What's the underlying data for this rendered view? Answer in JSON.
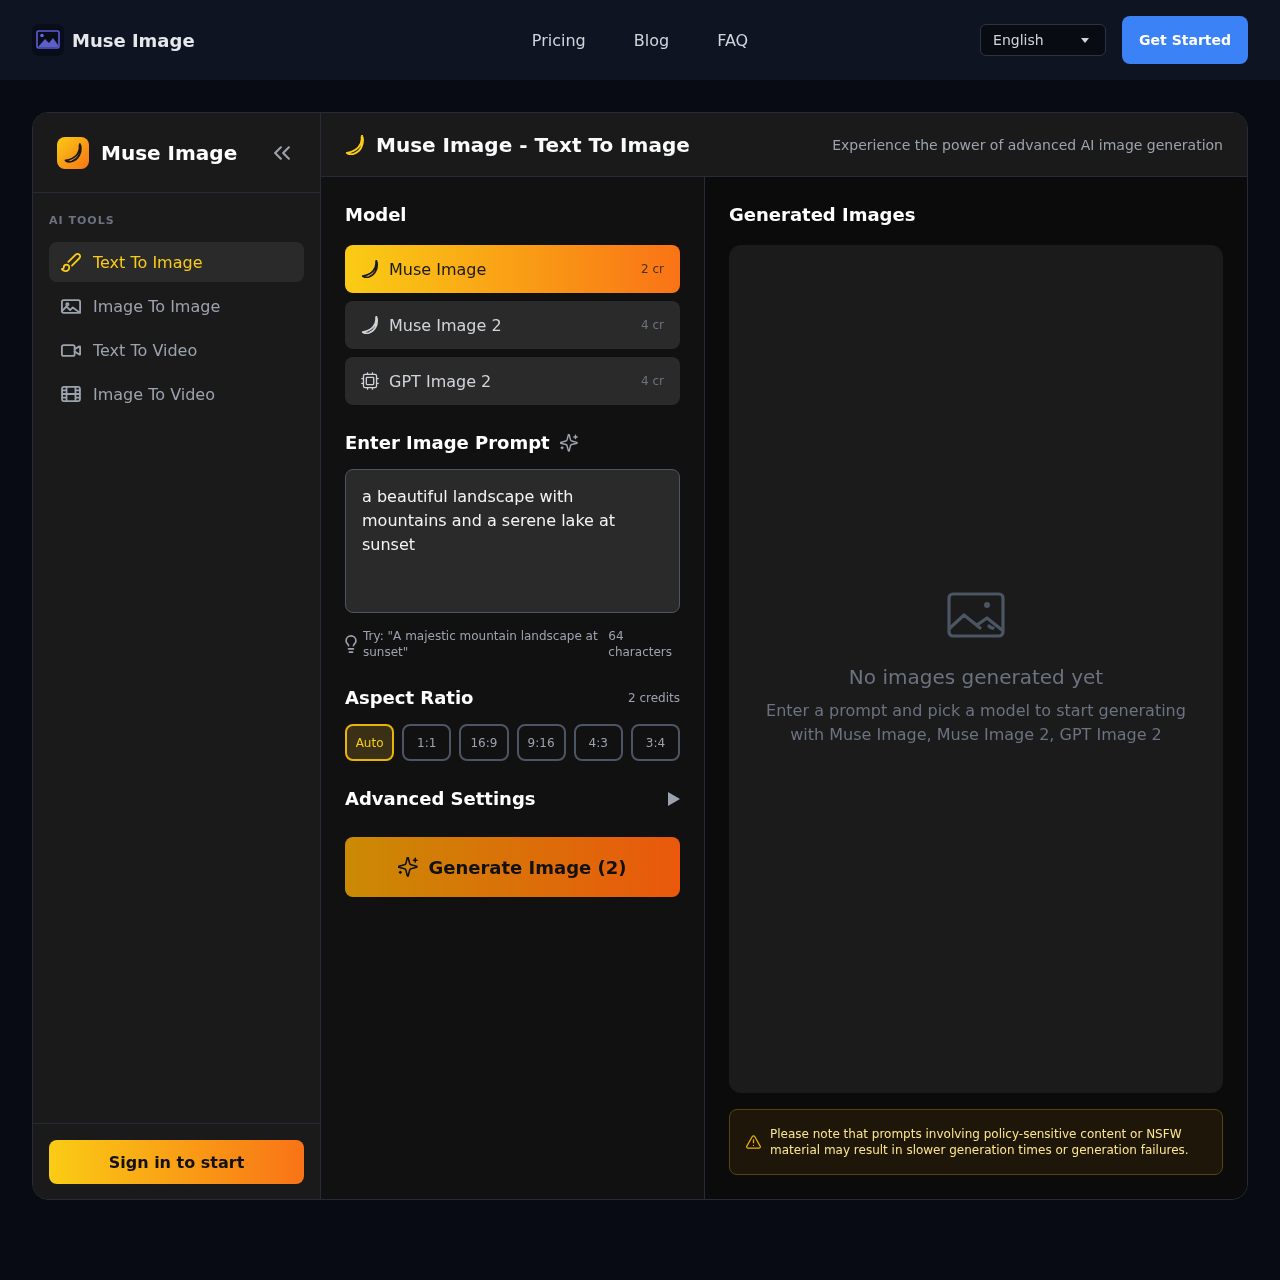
{
  "header": {
    "brand": "Muse Image",
    "nav": [
      {
        "label": "Pricing"
      },
      {
        "label": "Blog"
      },
      {
        "label": "FAQ"
      }
    ],
    "language": "English",
    "cta": "Get Started"
  },
  "sidebar": {
    "brand": "Muse Image",
    "section": "AI TOOLS",
    "items": [
      {
        "label": "Text To Image",
        "selected": true
      },
      {
        "label": "Image To Image",
        "selected": false
      },
      {
        "label": "Text To Video",
        "selected": false
      },
      {
        "label": "Image To Video",
        "selected": false
      }
    ],
    "sign_in": "Sign in to start"
  },
  "tool_header": {
    "title": "Muse Image - Text To Image",
    "subtitle": "Experience the power of advanced AI image generation"
  },
  "model": {
    "heading": "Model",
    "options": [
      {
        "name": "Muse Image",
        "credits": "2 cr",
        "selected": true
      },
      {
        "name": "Muse Image 2",
        "credits": "4 cr",
        "selected": false
      },
      {
        "name": "GPT Image 2",
        "credits": "4 cr",
        "selected": false
      }
    ]
  },
  "prompt": {
    "heading": "Enter Image Prompt",
    "value": "a beautiful landscape with mountains and a serene lake at sunset",
    "hint": "Try: \"A majestic mountain landscape at sunset\"",
    "count": "64 characters"
  },
  "aspect_ratio": {
    "heading": "Aspect Ratio",
    "credits": "2 credits",
    "options": [
      {
        "label": "Auto",
        "selected": true
      },
      {
        "label": "1:1",
        "selected": false
      },
      {
        "label": "16:9",
        "selected": false
      },
      {
        "label": "9:16",
        "selected": false
      },
      {
        "label": "4:3",
        "selected": false
      },
      {
        "label": "3:4",
        "selected": false
      }
    ]
  },
  "advanced_settings": {
    "label": "Advanced Settings",
    "expanded": false
  },
  "generate_button": "Generate Image (2)",
  "results": {
    "heading": "Generated Images",
    "empty_title": "No images generated yet",
    "empty_text": "Enter a prompt and pick a model to start generating with Muse Image, Muse Image 2, GPT Image 2",
    "notice": "Please note that prompts involving policy-sensitive content or NSFW material may result in slower generation times or generation failures."
  }
}
